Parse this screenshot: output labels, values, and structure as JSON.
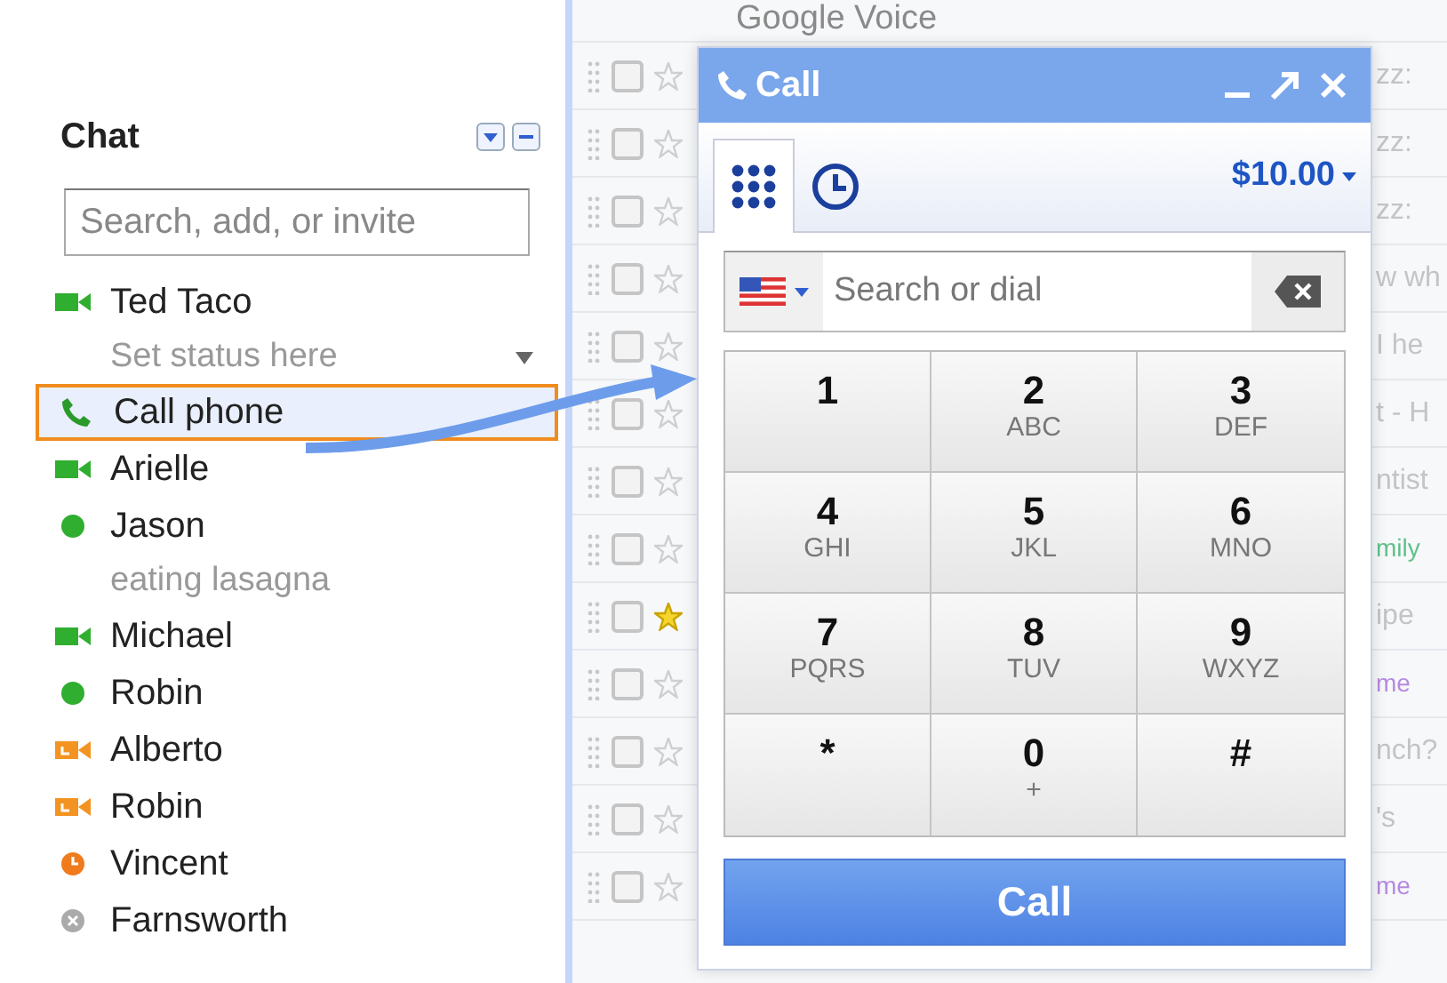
{
  "chat": {
    "title": "Chat",
    "search": {
      "placeholder": "Search, add, or invite"
    },
    "me": {
      "name": "Ted Taco",
      "kind": "video",
      "status_message": "Set status here"
    },
    "call_phone": {
      "label": "Call phone",
      "selected": true
    },
    "contacts": [
      {
        "name": "Arielle",
        "kind": "video"
      },
      {
        "name": "Jason",
        "kind": "available",
        "status_message": "eating lasagna"
      },
      {
        "name": "Michael",
        "kind": "video"
      },
      {
        "name": "Robin",
        "kind": "available"
      },
      {
        "name": "Alberto",
        "kind": "video_idle"
      },
      {
        "name": "Robin",
        "kind": "video_idle"
      },
      {
        "name": "Vincent",
        "kind": "idle"
      },
      {
        "name": "Farnsworth",
        "kind": "offline"
      }
    ]
  },
  "mail": {
    "rows": [
      {
        "sender": "Google Voice"
      },
      {
        "snippet": "zz:",
        "checked": false,
        "starred": false
      },
      {
        "snippet": "zz:",
        "checked": false,
        "starred": false
      },
      {
        "snippet": "zz:",
        "checked": false,
        "starred": false
      },
      {
        "snippet": "w wh",
        "checked": false,
        "starred": false
      },
      {
        "snippet": "I he",
        "checked": false,
        "starred": false
      },
      {
        "snippet": "t - H",
        "checked": false,
        "starred": false
      },
      {
        "snippet": "ntist",
        "checked": false,
        "starred": false
      },
      {
        "snippet": "mily",
        "checked": false,
        "starred": false,
        "color": "#5fc28a"
      },
      {
        "snippet": "ipe",
        "checked": false,
        "starred": true
      },
      {
        "snippet": "me",
        "checked": false,
        "starred": false,
        "color": "#b58ae0"
      },
      {
        "snippet": "nch?",
        "checked": false,
        "starred": false
      },
      {
        "snippet": "'s",
        "checked": false,
        "starred": false
      },
      {
        "snippet": "me",
        "checked": false,
        "starred": false,
        "color": "#b58ae0"
      }
    ]
  },
  "call_window": {
    "title": "Call",
    "tabs": [
      {
        "kind": "dialpad",
        "selected": true
      },
      {
        "kind": "history",
        "selected": false
      }
    ],
    "credit": "$10.00",
    "search": {
      "placeholder": "Search or dial"
    },
    "keys": [
      {
        "digit": "1"
      },
      {
        "digit": "2",
        "letters": "ABC"
      },
      {
        "digit": "3",
        "letters": "DEF"
      },
      {
        "digit": "4",
        "letters": "GHI"
      },
      {
        "digit": "5",
        "letters": "JKL"
      },
      {
        "digit": "6",
        "letters": "MNO"
      },
      {
        "digit": "7",
        "letters": "PQRS"
      },
      {
        "digit": "8",
        "letters": "TUV"
      },
      {
        "digit": "9",
        "letters": "WXYZ"
      },
      {
        "digit": "*"
      },
      {
        "digit": "0",
        "letters": "+"
      },
      {
        "digit": "#"
      }
    ],
    "call_button": "Call"
  }
}
